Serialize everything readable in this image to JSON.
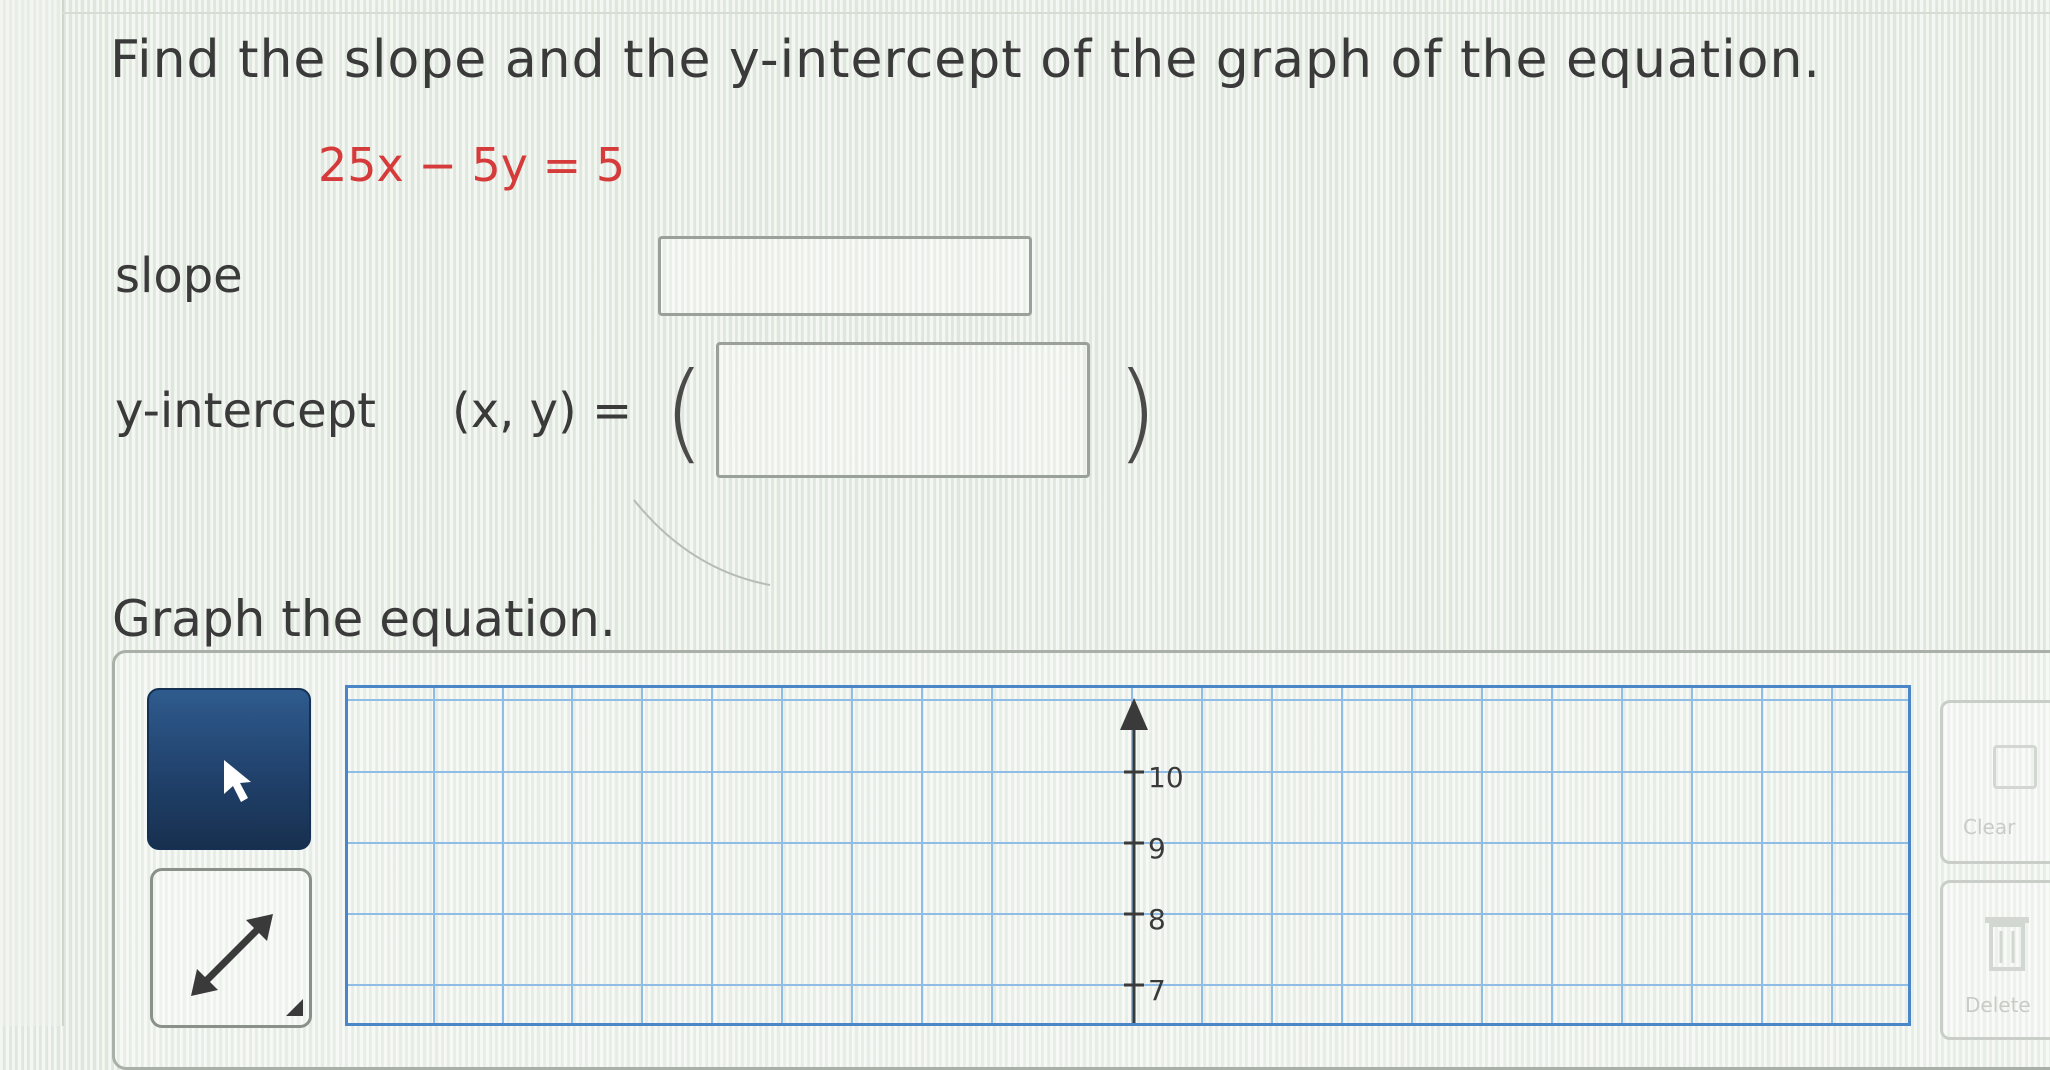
{
  "question": {
    "text": "Find the slope and the y-intercept of the graph of the equation.",
    "equation": "25x − 5y = 5"
  },
  "slope": {
    "label": "slope",
    "value": ""
  },
  "y_intercept": {
    "label": "y-intercept",
    "expression": "(x, y) =",
    "open_paren": "(",
    "close_paren": ")",
    "value": ""
  },
  "graph": {
    "prompt": "Graph the equation.",
    "y_ticks": [
      "10",
      "9",
      "8",
      "7"
    ],
    "tools": {
      "pointer": "pointer-arrow-icon",
      "line": "double-arrow-line-icon"
    },
    "side_buttons": {
      "clear": "Clear",
      "delete": "Delete"
    }
  },
  "colors": {
    "equation": "#d63b3b",
    "grid": "#4a86c8",
    "selected_tool": "#1f3f68"
  }
}
